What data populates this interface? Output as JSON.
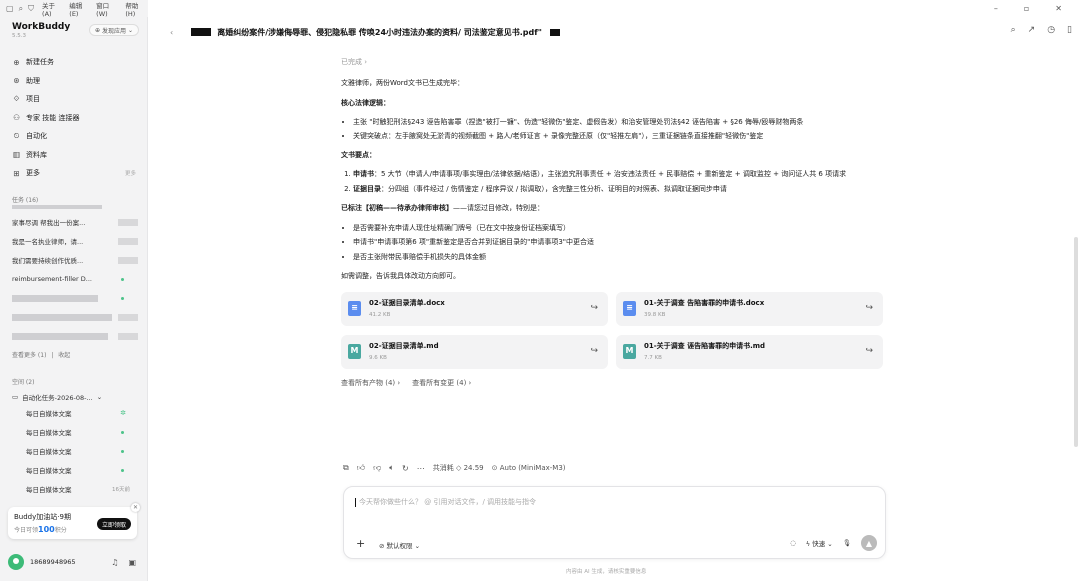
{
  "menubar": {
    "items": [
      "关于(A)",
      "编辑(E)",
      "窗口(W)",
      "帮助(H)"
    ]
  },
  "sidebar": {
    "brand": "WorkBuddy",
    "version": "5.5.3",
    "found_label": "发现应用",
    "nav": [
      {
        "label": "新建任务",
        "icon": "plus-circle-icon"
      },
      {
        "label": "助理",
        "icon": "assistant-icon"
      },
      {
        "label": "项目",
        "icon": "project-icon"
      },
      {
        "label": "专家 技能 连接器",
        "icon": "expert-icon"
      },
      {
        "label": "自动化",
        "icon": "automation-icon"
      },
      {
        "label": "资料库",
        "icon": "library-icon"
      },
      {
        "label": "更多",
        "icon": "more-icon",
        "trail": "更多"
      }
    ],
    "tasks_header": "任务 (16)",
    "tasks": [
      {
        "label": "家事尽调 帮我出一份案..."
      },
      {
        "label": "我是一名执业律师，请..."
      },
      {
        "label": "我们需要持续创作优质..."
      },
      {
        "label": "reimbursement-filler D..."
      }
    ],
    "tasks_more": "查看更多 (1)",
    "tasks_collapse": "收起",
    "space_header": "空间 (2)",
    "space_folder": "自动化任务-2026-08-...",
    "space_items": [
      {
        "label": "每日自媒体文案",
        "status": "running"
      },
      {
        "label": "每日自媒体文案",
        "status": "done"
      },
      {
        "label": "每日自媒体文案",
        "status": "done"
      },
      {
        "label": "每日自媒体文案",
        "status": "done"
      },
      {
        "label": "每日自媒体文案",
        "time": "16天前"
      }
    ],
    "promo": {
      "title": "Buddy加油站·9期",
      "subtitle_prefix": "今日可领",
      "amount": "100",
      "subtitle_suffix": "积分",
      "button": "立即领取"
    },
    "user": {
      "name": "18689948965"
    }
  },
  "titlebar": {
    "title": "离婚纠纷案件/涉嫌侮辱罪、侵犯隐私罪 传唤24小时违法办案的资料/             司法鉴定意见书.pdf\""
  },
  "message": {
    "done_label": "已完成",
    "intro": "文雅律师，两份Word文书已生成完毕：",
    "logic_heading": "核心法律逻辑：",
    "logic_items": [
      "主张          \"时触犯刑法§243 诬告陷害罪（捏造\"被打一镰\"、伪造\"轻微伤\"鉴定、虚假告发）和治安管理处罚法§42 诬告陷害 + §26 侮辱/殴辱财物两条",
      "关键突破点：左手腋窝处无淤青的视频截图 + 路人/老师证言 + 录像完整还原（仅\"轻推左肩\"），三重证据链条直接推翻\"轻微伤\"鉴定"
    ],
    "doc_heading": "文书要点：",
    "doc_items": [
      {
        "bold": "申请书",
        "text": "：5 大节（申请人/申请事项/事实理由/法律依据/结语），主张追究刑事责任 + 治安违法责任 + 民事赔偿 + 重新鉴定 + 调取监控 + 询问证人共 6 项请求"
      },
      {
        "bold": "证据目录",
        "text": "：分四组（事件经过 / 伤情鉴定 / 程序异议 / 拟调取），含完整三性分析、证明目的对照表、拟调取证据同步申请"
      }
    ],
    "mark_heading": "已标注【初稿——待承办律师审核】",
    "mark_tail": "——请您过目修改，特别是：",
    "mark_items": [
      "是否需要补充申请人现住址精确门牌号（已在文中按身份证档案填写）",
      "申请书\"申请事项第6 项\"重新鉴定是否合并到证据目录的\"申请事项3\"中更合适",
      "是否主张附带民事赔偿手机损失的具体金额"
    ],
    "outro": "如需调整，告诉我具体改动方向即可。",
    "files": [
      {
        "name": "02-证据目录清单.docx",
        "size": "41.2 KB",
        "type": "docx"
      },
      {
        "name": "01-关于调查         告陷害罪的申请书.docx",
        "size": "39.8 KB",
        "type": "docx"
      },
      {
        "name": "02-证据目录清单.md",
        "size": "9.6 KB",
        "type": "md"
      },
      {
        "name": "01-关于调查        诬告陷害罪的申请书.md",
        "size": "7.7 KB",
        "type": "md"
      }
    ],
    "view_outputs": "查看所有产物 (4)",
    "view_changes": "查看所有变更 (4)"
  },
  "actions": {
    "cost_label": "共消耗",
    "cost_value": "24.59",
    "model": "Auto (MiniMax-M3)"
  },
  "composer": {
    "placeholder": "今天帮你做些什么？ @ 引用对话文件，/ 调用技能与指令",
    "permission": "默认权限",
    "mode": "快速"
  },
  "footnote": "内容由 AI 生成，请核实重要信息",
  "colors": {
    "accent": "#1a73e8",
    "status_green": "#4cc38a",
    "sidebar_bg": "#f3f3f4"
  }
}
